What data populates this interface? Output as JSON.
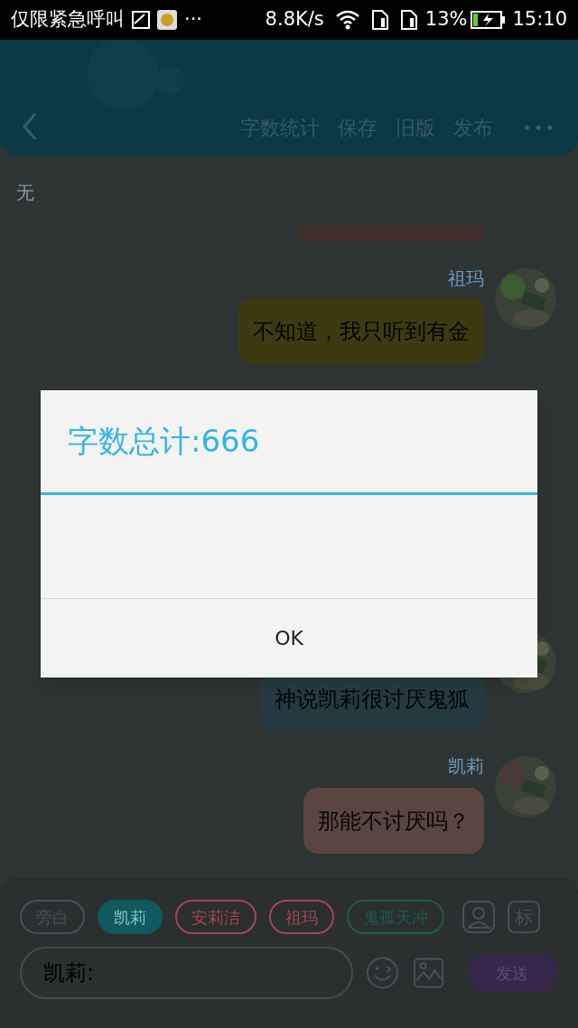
{
  "status_bar": {
    "carrier": "仅限紧急呼叫",
    "more": "···",
    "speed": "8.8K/s",
    "battery": "13%",
    "time": "15:10"
  },
  "header": {
    "actions": [
      "字数统计",
      "保存",
      "旧版",
      "发布"
    ],
    "more": "•••"
  },
  "note": "无",
  "messages": [
    {
      "sender": "祖玛",
      "text": "不知道，我只听到有金",
      "color": "#3d3a12"
    },
    {
      "text": "神说凯莉很讨厌鬼狐",
      "color": "#253a40"
    },
    {
      "sender": "凯莉",
      "text": "那能不讨厌吗？",
      "color": "#5a4540"
    }
  ],
  "roles": [
    {
      "label": "旁白",
      "color": "#4a5058",
      "selected": false
    },
    {
      "label": "凯莉",
      "color": "#0e5a5e",
      "selected": true
    },
    {
      "label": "安莉洁",
      "color": "#a84454",
      "selected": false
    },
    {
      "label": "祖玛",
      "color": "#a84454",
      "selected": false
    },
    {
      "label": "鬼孤天冲",
      "color": "#1f5a4c",
      "selected": false
    }
  ],
  "mark_button": "标",
  "composer": {
    "prefix": "凯莉:",
    "send": "发送"
  },
  "dialog": {
    "title": "字数总计:666",
    "button": "OK"
  }
}
